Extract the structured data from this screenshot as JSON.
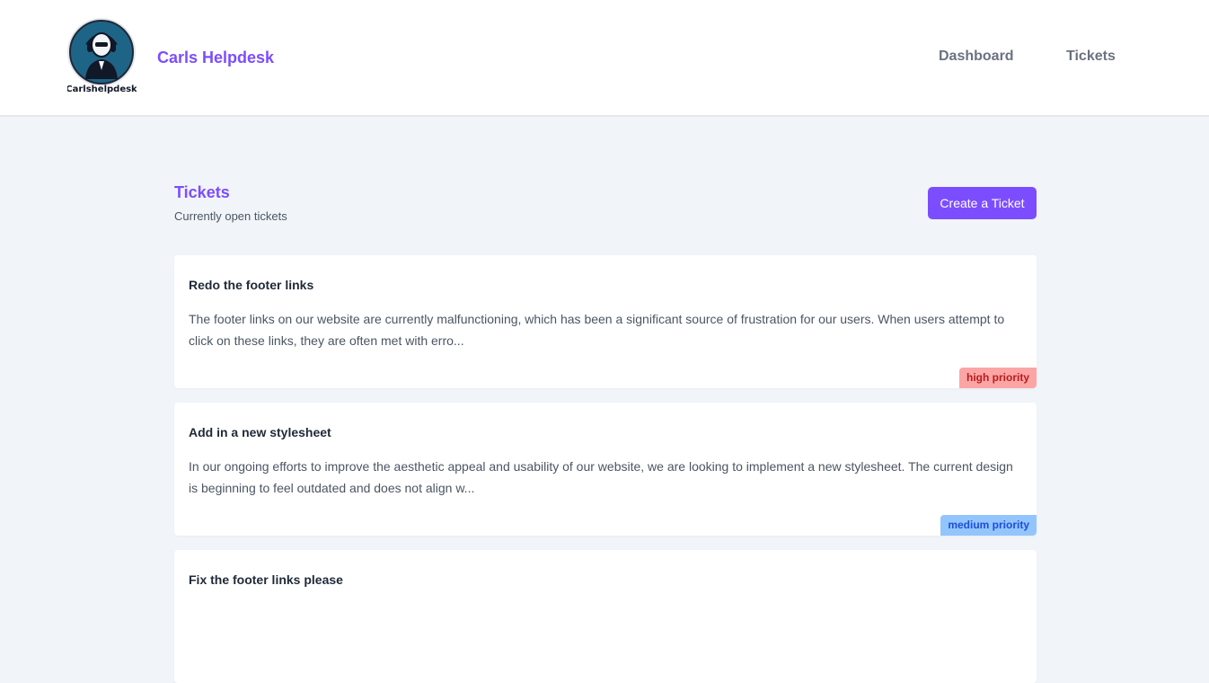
{
  "header": {
    "brand": "Carls Helpdesk",
    "logo_text": "Carlshelpdesk",
    "nav": [
      {
        "label": "Dashboard"
      },
      {
        "label": "Tickets"
      }
    ]
  },
  "main": {
    "title": "Tickets",
    "subtitle": "Currently open tickets",
    "create_button": "Create a Ticket",
    "tickets": [
      {
        "title": "Redo the footer links",
        "body": "The footer links on our website are currently malfunctioning, which has been a significant source of frustration for our users. When users attempt to click on these links, they are often met with erro...",
        "priority": "high priority"
      },
      {
        "title": "Add in a new stylesheet",
        "body": "In our ongoing efforts to improve the aesthetic appeal and usability of our website, we are looking to implement a new stylesheet. The current design is beginning to feel outdated and does not align w...",
        "priority": "medium priority"
      },
      {
        "title": "Fix the footer links please",
        "body": "",
        "priority": ""
      }
    ]
  },
  "colors": {
    "accent": "#7c4dff",
    "background": "#f1f5f9",
    "high_priority_bg": "#fca5a5",
    "medium_priority_bg": "#93c5fd"
  }
}
